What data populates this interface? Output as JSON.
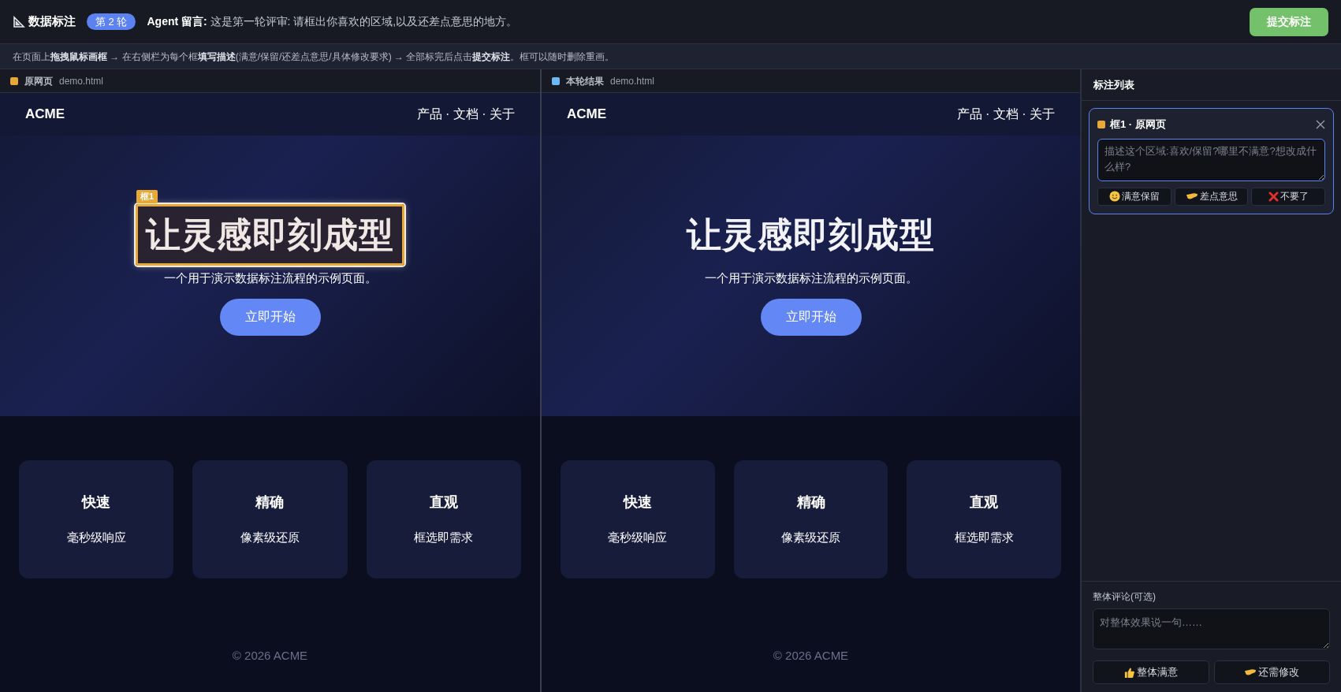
{
  "header": {
    "title": "数据标注",
    "round_badge": "第 2 轮",
    "agent_message": "**Agent 留言:** 这是第一轮评审: 请框出你喜欢的区域,以及还差点意思的地方。",
    "submit_button": "提交标注"
  },
  "instructions": "在页面上**拖拽鼠标画框** → 在右侧栏为每个框**填写描述**(满意/保留/还差点意思/具体修改要求) → 全部标完后点击**提交标注**。框可以随时删除重画。",
  "panes": [
    {
      "label": "原网页",
      "file": "demo.html",
      "color": "#e8a838",
      "page": {
        "logo": "ACME",
        "nav": "产品 · 文档 · 关于",
        "heading": "让灵感即刻成型",
        "subtitle": "一个用于演示数据标注流程的示例页面。",
        "cta": "立即开始",
        "cards": [
          {
            "title": "快速",
            "text": "毫秒级响应"
          },
          {
            "title": "精确",
            "text": "像素级还原"
          },
          {
            "title": "直观",
            "text": "框选即需求"
          }
        ],
        "footer": "© 2026 ACME"
      },
      "annotations": [
        {
          "label": "框1",
          "color": "#e8a838"
        }
      ]
    },
    {
      "label": "本轮结果",
      "file": "demo.html",
      "color": "#6cb8f5",
      "page": {
        "logo": "ACME",
        "nav": "产品 · 文档 · 关于",
        "heading": "让灵感即刻成型",
        "subtitle": "一个用于演示数据标注流程的示例页面。",
        "cta": "立即开始",
        "cards": [
          {
            "title": "快速",
            "text": "毫秒级响应"
          },
          {
            "title": "精确",
            "text": "像素级还原"
          },
          {
            "title": "直观",
            "text": "框选即需求"
          }
        ],
        "footer": "© 2026 ACME"
      }
    }
  ],
  "sidebar": {
    "title": "标注列表",
    "annotation_cards": [
      {
        "title": "框1 · 原网页",
        "color": "#e8a838",
        "selected": true,
        "placeholder": "描述这个区域:喜欢/保留?哪里不满意?想改成什么样?",
        "buttons": [
          {
            "kind": "smile",
            "label": "满意保留"
          },
          {
            "kind": "hand",
            "label": "差点意思"
          },
          {
            "kind": "cross",
            "label": "不要了"
          }
        ]
      }
    ],
    "overall": {
      "label": "整体评论(可选)",
      "placeholder": "对整体效果说一句……",
      "buttons": [
        {
          "kind": "thumb",
          "label": "整体满意"
        },
        {
          "kind": "hand",
          "label": "还需修改"
        }
      ]
    }
  }
}
